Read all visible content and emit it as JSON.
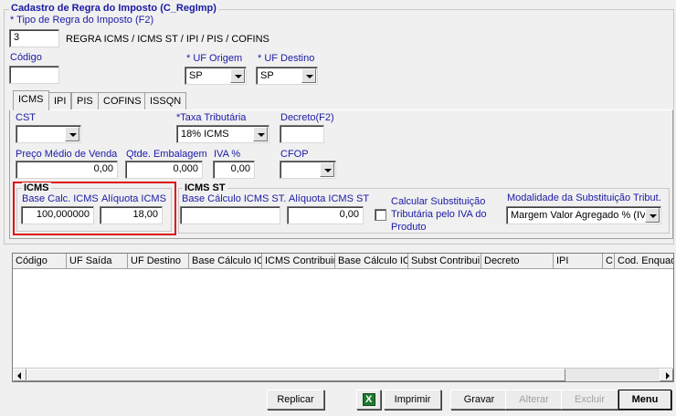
{
  "window": {
    "title": "Cadastro de Regra do Imposto (C_RegImp)"
  },
  "header": {
    "tipo_regra_label": "* Tipo de Regra do Imposto (F2)",
    "tipo_regra_value": "3",
    "tipo_regra_desc": "REGRA ICMS / ICMS ST / IPI / PIS / COFINS",
    "codigo_label": "Código",
    "codigo_value": "",
    "uf_origem_label": "* UF Origem",
    "uf_origem_value": "SP",
    "uf_destino_label": "* UF Destino",
    "uf_destino_value": "SP"
  },
  "tabs": [
    {
      "label": "ICMS",
      "active": true
    },
    {
      "label": "IPI"
    },
    {
      "label": "PIS"
    },
    {
      "label": "COFINS"
    },
    {
      "label": "ISSQN"
    }
  ],
  "icms_tab": {
    "cst_label": "CST",
    "cst_value": "",
    "taxa_label": "*Taxa Tributária",
    "taxa_value": "18% ICMS",
    "decreto_label": "Decreto(F2)",
    "decreto_value": "",
    "preco_medio_label": "Preço Médio de Venda",
    "preco_medio_value": "0,00",
    "qtde_emb_label": "Qtde. Embalagem",
    "qtde_emb_value": "0,000",
    "iva_label": "IVA %",
    "iva_value": "0,00",
    "cfop_label": "CFOP",
    "cfop_value": "",
    "icms_group": {
      "title": "ICMS",
      "base_calc_label": "Base Calc. ICMS",
      "base_calc_value": "100,000000",
      "aliquota_label": "Alíquota ICMS",
      "aliquota_value": "18,00"
    },
    "icms_st_group": {
      "title": "ICMS ST",
      "base_calc_st_label": "Base Cálculo ICMS ST.",
      "base_calc_st_value": "",
      "aliquota_st_label": "Alíquota ICMS ST",
      "aliquota_st_value": "0,00",
      "calcular_sub_label_1": "Calcular Substituição",
      "calcular_sub_label_2": "Tributária pelo IVA do",
      "calcular_sub_label_3": "Produto",
      "modalidade_label": "Modalidade da Substituição Tribut.",
      "modalidade_value": "Margem Valor Agregado % (IV"
    }
  },
  "grid": {
    "columns": [
      "Código",
      "UF Saída",
      "UF Destino",
      "Base Cálculo IC",
      "ICMS Contribuin",
      "Base Cálculo IC",
      "Subst Contribui",
      "Decreto",
      "IPI",
      "C",
      "Cod. Enquad"
    ]
  },
  "buttons": {
    "replicar": "Replicar",
    "imprimir": "Imprimir",
    "gravar": "Gravar",
    "alterar": "Alterar",
    "excluir": "Excluir",
    "menu": "Menu"
  },
  "colors": {
    "label_blue": "#1a1aa6",
    "highlight_red": "#e01010",
    "excel_green": "#1e7a2e"
  }
}
